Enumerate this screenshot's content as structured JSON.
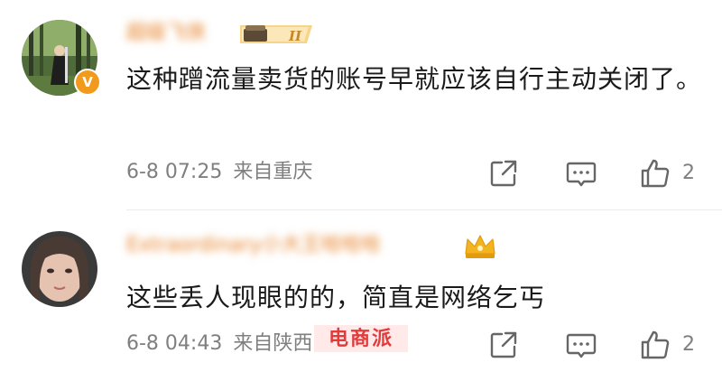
{
  "comments": [
    {
      "username": "超级飞侠",
      "badge_text": "II",
      "text": "这种蹭流量卖货的账号早就应该自行主动关闭了。",
      "date": "6-8 07:25",
      "location": "来自重庆",
      "likes": "2",
      "verified_glyph": "V"
    },
    {
      "username": "Extraordinary小大王哈哈哈",
      "text": "这些丢人现眼的的，简直是网络乞丐",
      "date": "6-8 04:43",
      "location": "来自陕西",
      "likes": "2"
    }
  ],
  "watermark": "电商派",
  "icons": {
    "share": "share-icon",
    "reply": "comment-icon",
    "like": "thumbs-up-icon"
  },
  "colors": {
    "username": "#e67e22",
    "meta": "#7f7f7f",
    "text": "#1a1a1a",
    "verified": "#f29a1b"
  }
}
